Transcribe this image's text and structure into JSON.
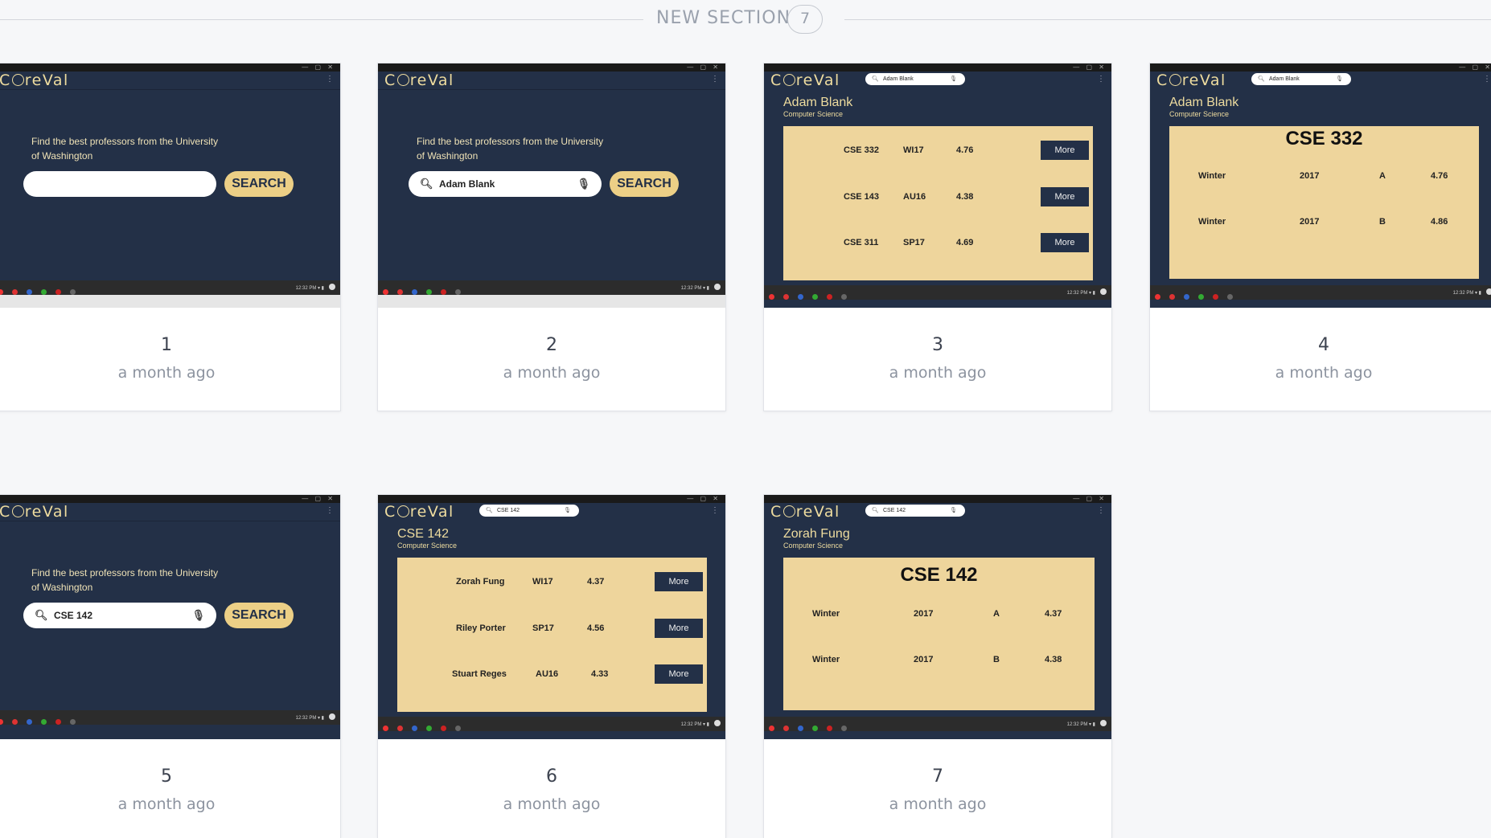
{
  "section": {
    "title": "NEW SECTION",
    "count": "7"
  },
  "logo": {
    "pre": "C",
    "post": "reVal"
  },
  "tagline": "Find the best professors from the University of Washington",
  "search_btn": "SEARCH",
  "more": "More",
  "cards": [
    {
      "num": "1",
      "time": "a month ago",
      "query": ""
    },
    {
      "num": "2",
      "time": "a month ago",
      "query": "Adam Blank"
    },
    {
      "num": "3",
      "time": "a month ago",
      "top_query": "Adam Blank",
      "name": "Adam Blank",
      "dept": "Computer Science",
      "rows": [
        [
          "CSE 332",
          "WI17",
          "4.76"
        ],
        [
          "CSE 143",
          "AU16",
          "4.38"
        ],
        [
          "CSE 311",
          "SP17",
          "4.69"
        ]
      ]
    },
    {
      "num": "4",
      "time": "a month ago",
      "top_query": "Adam Blank",
      "name": "Adam Blank",
      "dept": "Computer Science",
      "course": "CSE 332",
      "detail": [
        [
          "Winter",
          "2017",
          "A",
          "4.76"
        ],
        [
          "Winter",
          "2017",
          "B",
          "4.86"
        ]
      ]
    },
    {
      "num": "5",
      "time": "a month ago",
      "query": "CSE 142"
    },
    {
      "num": "6",
      "time": "a month ago",
      "top_query": "CSE 142",
      "name": "CSE 142",
      "dept": "Computer Science",
      "rows": [
        [
          "Zorah Fung",
          "WI17",
          "4.37"
        ],
        [
          "Riley Porter",
          "SP17",
          "4.56"
        ],
        [
          "Stuart Reges",
          "AU16",
          "4.33"
        ]
      ]
    },
    {
      "num": "7",
      "time": "a month ago",
      "top_query": "CSE 142",
      "name": "Zorah Fung",
      "dept": "Computer Science",
      "course": "CSE 142",
      "detail": [
        [
          "Winter",
          "2017",
          "A",
          "4.37"
        ],
        [
          "Winter",
          "2017",
          "B",
          "4.38"
        ]
      ]
    }
  ],
  "colors": {
    "app_bg": "#233047",
    "accent": "#eccf86",
    "panel": "#eed59c",
    "page_bg": "#f6f7f9"
  },
  "icons": [
    "search-icon",
    "mic-icon",
    "kebab-menu-icon"
  ]
}
